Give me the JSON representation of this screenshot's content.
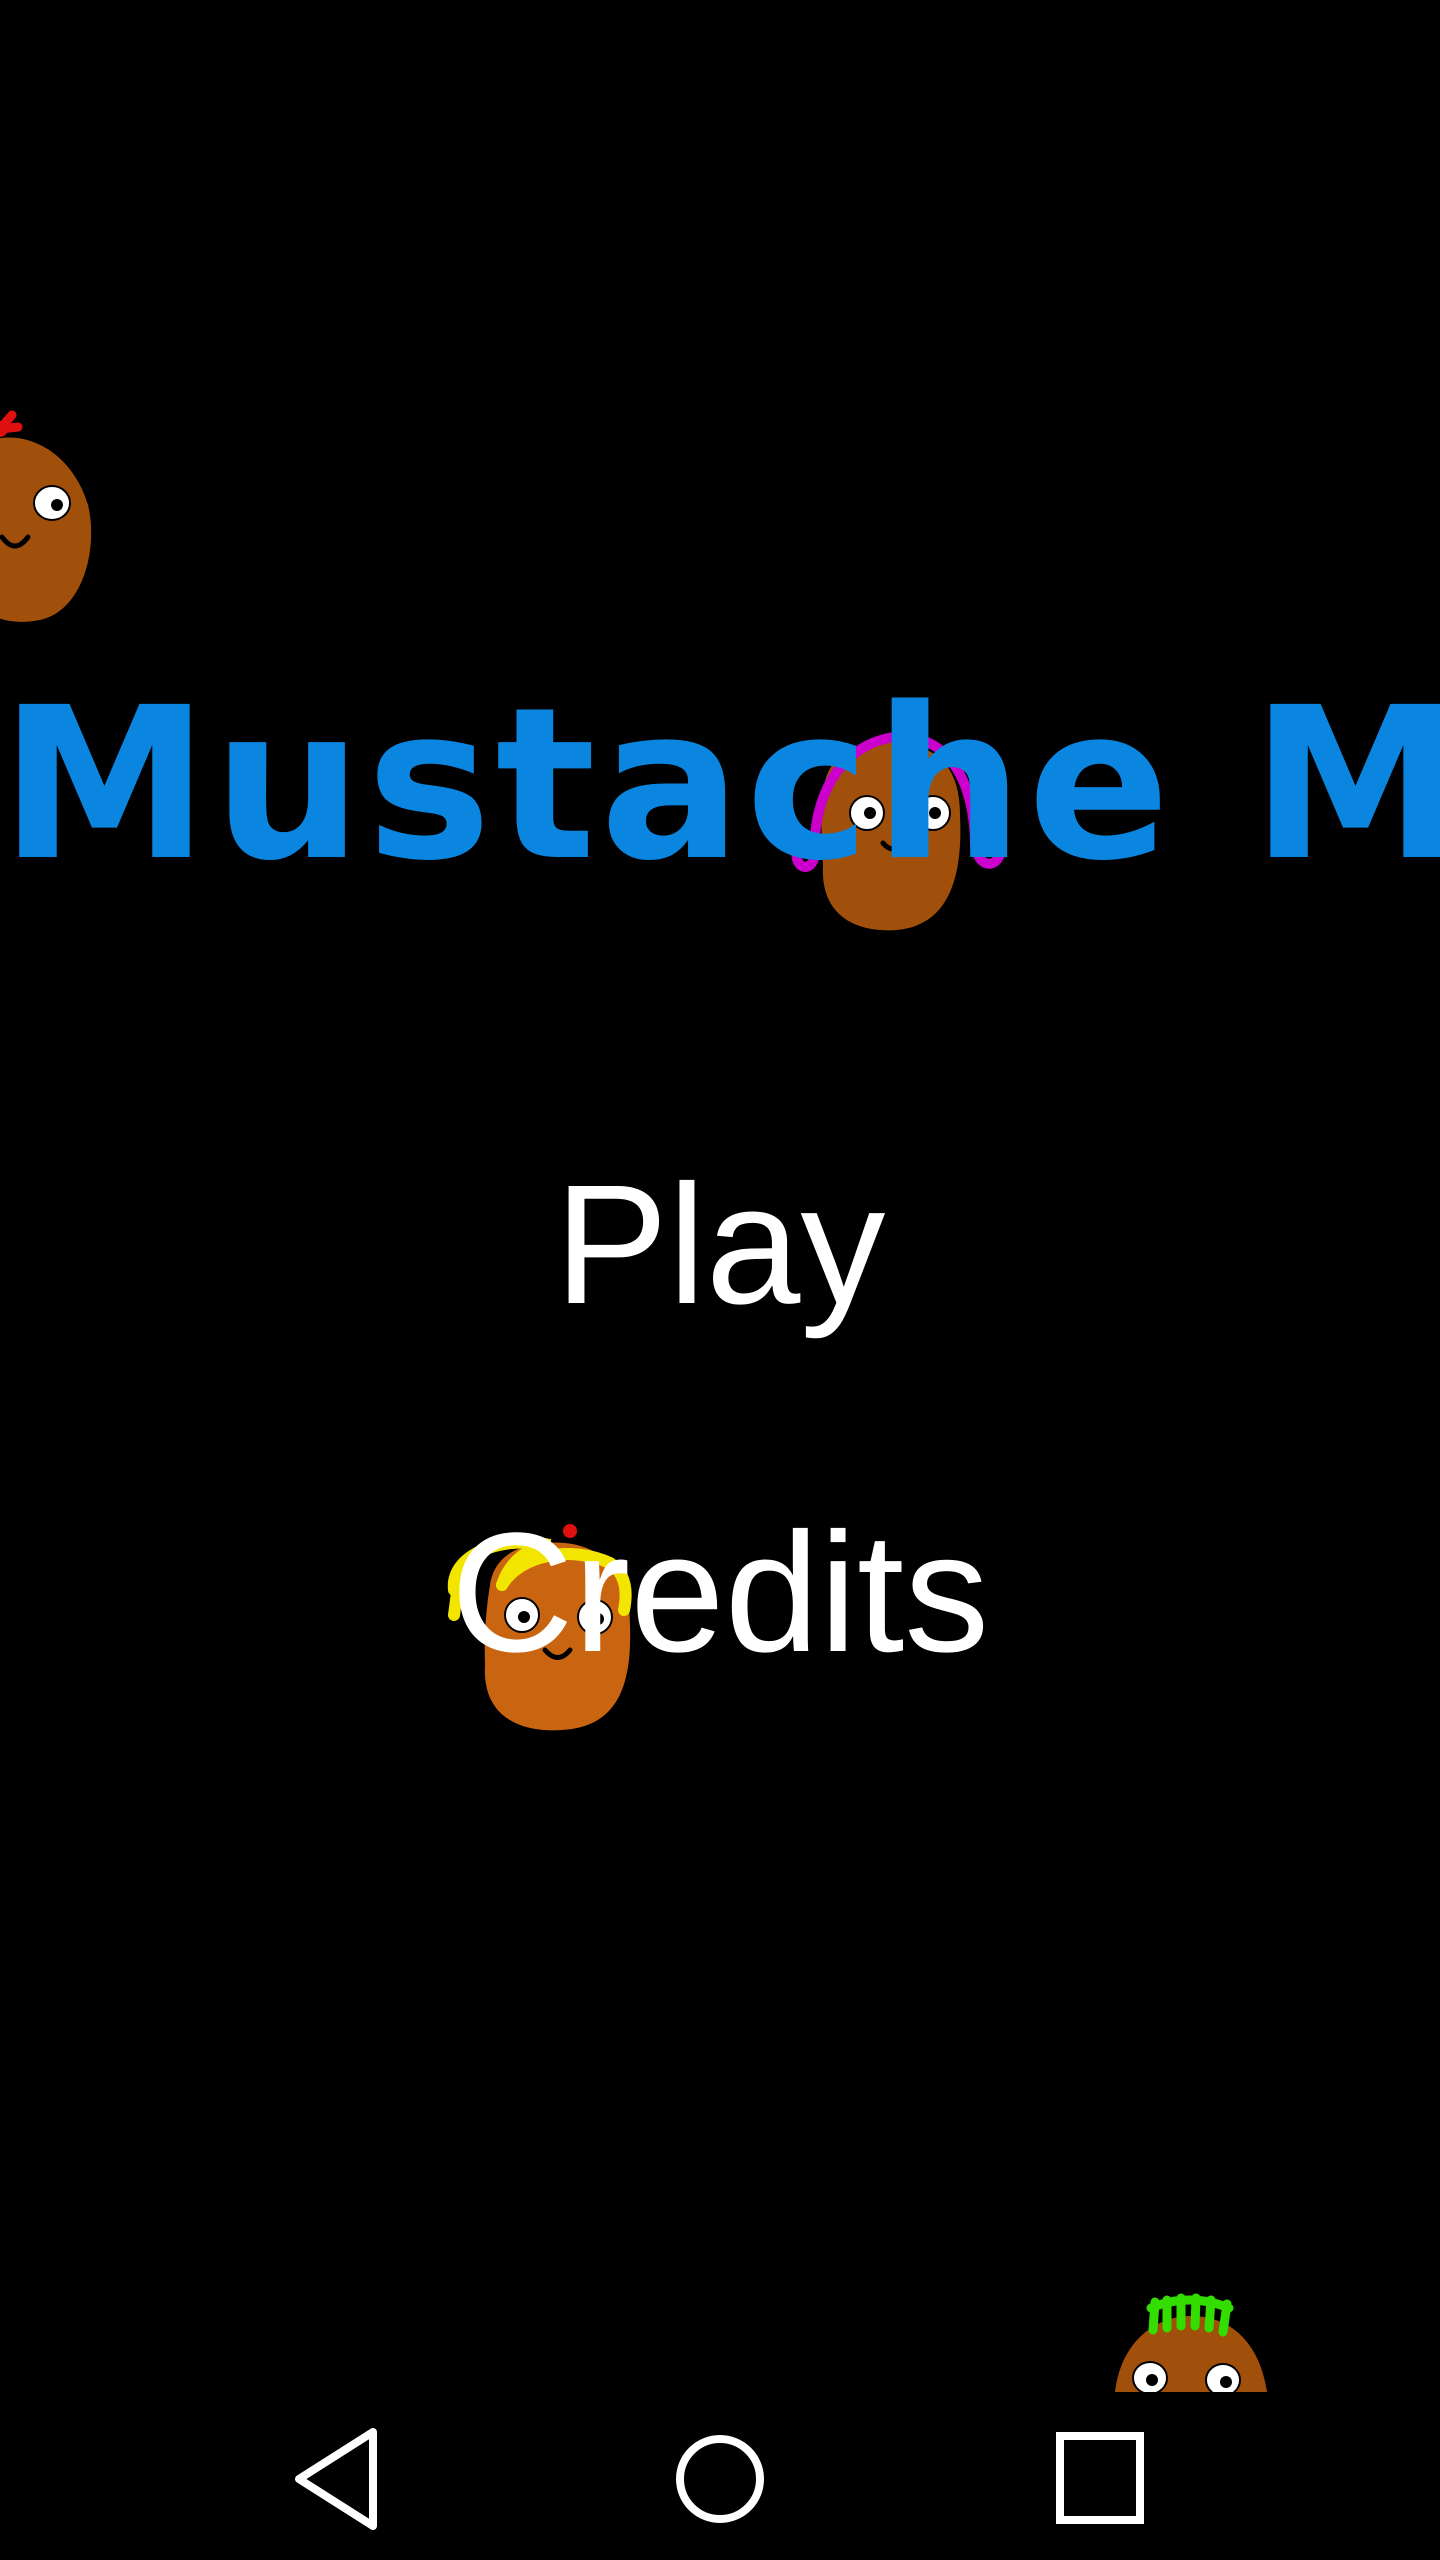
{
  "title": "Mustache Me",
  "menu": {
    "play_label": "Play",
    "credits_label": "Credits"
  },
  "characters": [
    {
      "name": "potato-red-bow",
      "hair_color": "#e01010"
    },
    {
      "name": "potato-magenta-hair",
      "hair_color": "#cc00cc"
    },
    {
      "name": "potato-blonde-hair",
      "hair_color": "#f2e600"
    },
    {
      "name": "potato-green-hair",
      "hair_color": "#33dd00"
    }
  ],
  "navbar": {
    "icons": [
      "back-icon",
      "home-icon",
      "recents-icon"
    ]
  },
  "colors": {
    "background": "#000000",
    "title": "#0a86e0",
    "menu_text": "#ffffff",
    "potato_body": "#a0500a"
  }
}
